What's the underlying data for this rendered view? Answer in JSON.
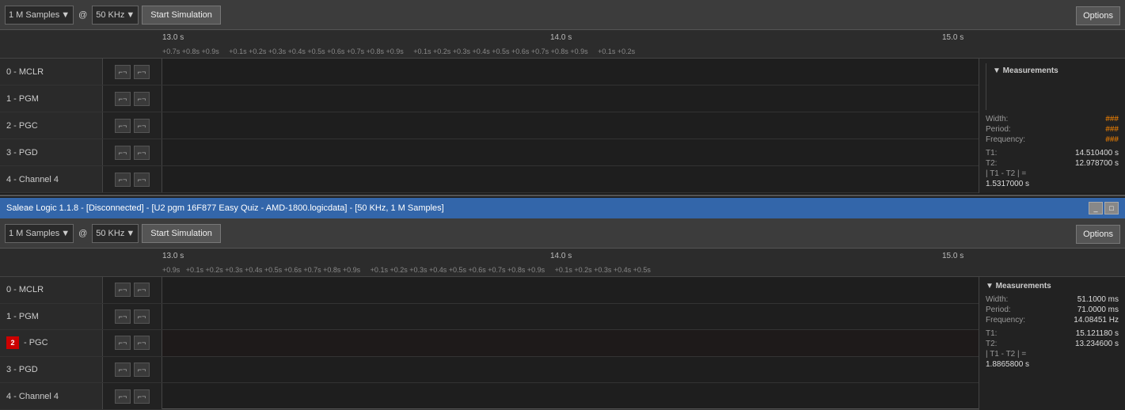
{
  "top_panel": {
    "toolbar": {
      "samples_label": "1 M Samples",
      "at_label": "@",
      "freq_label": "50 KHz",
      "start_btn": "Start Simulation",
      "options_btn": "Options"
    },
    "ruler": {
      "major_times": [
        "13.0 s",
        "14.0 s",
        "15.0 s"
      ],
      "minor_ticks": [
        "+0.7s",
        "+0.8s",
        "+0.9s",
        "+0.1s",
        "+0.2s",
        "+0.3s",
        "+0.4s",
        "+0.5s",
        "+0.6s",
        "+0.7s",
        "+0.8s",
        "+0.9s",
        "+0.1s",
        "+0.2s",
        "+0.3s",
        "+0.4s",
        "+0.5s",
        "+0.6s",
        "+0.7s",
        "+0.8s",
        "+0.9s",
        "+0.1s",
        "+0.2s"
      ]
    },
    "channels": [
      {
        "id": "0",
        "name": "MCLR",
        "color": "#ccc"
      },
      {
        "id": "1",
        "name": "PGM",
        "color": "#ccc"
      },
      {
        "id": "2",
        "name": "PGC",
        "color": "#ccc"
      },
      {
        "id": "3",
        "name": "PGD",
        "color": "#ccc"
      },
      {
        "id": "4",
        "name": "Channel 4",
        "color": "#ccc"
      }
    ],
    "measurements": {
      "title": "▼ Measurements",
      "width_label": "Width:",
      "width_value": "###",
      "period_label": "Period:",
      "period_value": "###",
      "freq_label": "Frequency:",
      "freq_value": "###",
      "t1_label": "T1:",
      "t1_value": "14.510400 s",
      "t2_label": "T2:",
      "t2_value": "12.978700 s",
      "diff_label": "| T1 - T2 | =",
      "diff_value": "1.5317000 s"
    }
  },
  "title_bar": {
    "text": "Saleae Logic 1.1.8 - [Disconnected] - [U2 pgm 16F877 Easy Quiz - AMD-1800.logicdata] - [50 KHz, 1 M Samples]",
    "min_btn": "_",
    "max_btn": "□",
    "close_btn": "✕"
  },
  "bottom_panel": {
    "toolbar": {
      "samples_label": "1 M Samples",
      "at_label": "@",
      "freq_label": "50 KHz",
      "start_btn": "Start Simulation",
      "options_btn": "Options"
    },
    "ruler": {
      "minor_ticks": [
        "+0.9s",
        "+0.1s",
        "+0.2s",
        "+0.3s",
        "+0.4s",
        "+0.5s",
        "+0.6s",
        "+0.7s",
        "+0.8s",
        "+0.9s",
        "+0.1s",
        "+0.2s",
        "+0.3s",
        "+0.4s",
        "+0.5s",
        "+0.6s",
        "+0.7s",
        "+0.8s",
        "+0.9s",
        "+0.1s",
        "+0.2s",
        "+0.3s",
        "+0.4s",
        "+0.5s"
      ]
    },
    "channels": [
      {
        "id": "0",
        "name": "MCLR",
        "color": "#ccc"
      },
      {
        "id": "1",
        "name": "PGM",
        "color": "#ccc"
      },
      {
        "id": "2",
        "name": "PGC",
        "color": "#ccc",
        "badge_color": "#c00"
      },
      {
        "id": "3",
        "name": "PGD",
        "color": "#ccc"
      },
      {
        "id": "4",
        "name": "Channel 4",
        "color": "#ccc"
      }
    ],
    "measurements": {
      "title": "▼ Measurements",
      "width_label": "Width:",
      "width_value": "51.1000 ms",
      "period_label": "Period:",
      "period_value": "71.0000 ms",
      "freq_label": "Frequency:",
      "freq_value": "14.08451 Hz",
      "t1_label": "T1:",
      "t1_value": "15.121180 s",
      "t2_label": "T2:",
      "t2_value": "13.234600 s",
      "diff_label": "| T1 - T2 | =",
      "diff_value": "1.8865800 s"
    }
  }
}
